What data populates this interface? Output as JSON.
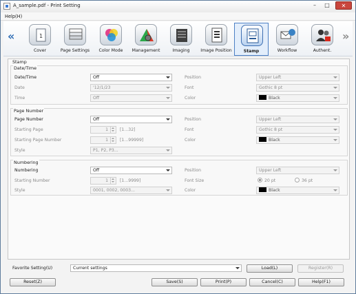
{
  "window": {
    "title": "A_sample.pdf - Print Setting",
    "minimize": "–",
    "maximize": "□",
    "close": "✕"
  },
  "menu": {
    "help": "Help(H)"
  },
  "toolbar": {
    "prev": "«",
    "next": "»",
    "tools": [
      {
        "label": "Cover",
        "icon": "cover-icon"
      },
      {
        "label": "Page Settings",
        "icon": "page-settings-icon"
      },
      {
        "label": "Color Mode",
        "icon": "color-mode-icon"
      },
      {
        "label": "Management",
        "icon": "management-icon"
      },
      {
        "label": "Imaging",
        "icon": "imaging-icon"
      },
      {
        "label": "Image Position",
        "icon": "image-position-icon"
      },
      {
        "label": "Stamp",
        "icon": "stamp-icon",
        "active": true
      },
      {
        "label": "Workflow",
        "icon": "workflow-icon"
      },
      {
        "label": "Authent.",
        "icon": "authentication-icon"
      }
    ]
  },
  "stamp": {
    "title": "Stamp",
    "datetime": {
      "group": "Date/Time",
      "label": "Date/Time",
      "value": "Off",
      "date_label": "Date",
      "date_value": "'12/1/23",
      "time_label": "Time",
      "time_value": "Off",
      "position_label": "Position",
      "position_value": "Upper Left",
      "font_label": "Font",
      "font_value": "Gothic 8 pt",
      "color_label": "Color",
      "color_value": "Black"
    },
    "page_number": {
      "group": "Page Number",
      "label": "Page Number",
      "value": "Off",
      "start_page_label": "Starting Page",
      "start_page_value": "1",
      "start_page_range": "[1...32]",
      "start_num_label": "Starting Page Number",
      "start_num_value": "1",
      "start_num_range": "[1...99999]",
      "style_label": "Style",
      "style_value": "P1, P2, P3...",
      "position_label": "Position",
      "position_value": "Upper Left",
      "font_label": "Font",
      "font_value": "Gothic 8 pt",
      "color_label": "Color",
      "color_value": "Black"
    },
    "numbering": {
      "group": "Numbering",
      "label": "Numbering",
      "value": "Off",
      "start_label": "Starting Number",
      "start_value": "1",
      "start_range": "[1...9999]",
      "style_label": "Style",
      "style_value": "0001, 0002, 0003...",
      "position_label": "Position",
      "position_value": "Upper Left",
      "fontsize_label": "Font Size",
      "fontsize_opt1": "20 pt",
      "fontsize_opt2": "36 pt",
      "color_label": "Color",
      "color_value": "Black"
    }
  },
  "favorite": {
    "label": "Favorite Setting(U)",
    "value": "Current settings",
    "load": "Load(L)",
    "register": "Register(R)"
  },
  "buttons": {
    "reset": "Reset(Z)",
    "save": "Save(S)",
    "print": "Print(P)",
    "cancel": "Cancel(C)",
    "help": "Help(F1)"
  }
}
